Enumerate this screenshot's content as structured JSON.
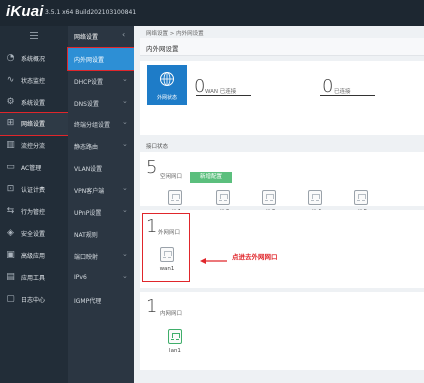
{
  "header": {
    "logo": "iKuai",
    "version": "3.5.1 x64 Build202103100841"
  },
  "sidebar": {
    "items": [
      {
        "label": "系统概况",
        "icon": "dashboard-icon"
      },
      {
        "label": "状态监控",
        "icon": "monitor-icon"
      },
      {
        "label": "系统设置",
        "icon": "gear-icon"
      },
      {
        "label": "网络设置",
        "icon": "network-icon"
      },
      {
        "label": "流控分流",
        "icon": "flow-icon"
      },
      {
        "label": "AC管理",
        "icon": "ac-icon"
      },
      {
        "label": "认证计费",
        "icon": "auth-icon"
      },
      {
        "label": "行为管控",
        "icon": "behavior-icon"
      },
      {
        "label": "安全设置",
        "icon": "shield-icon"
      },
      {
        "label": "高级应用",
        "icon": "advanced-icon"
      },
      {
        "label": "应用工具",
        "icon": "tools-icon"
      },
      {
        "label": "日志中心",
        "icon": "log-icon"
      }
    ]
  },
  "subnav": {
    "header": "网络设置",
    "items": [
      {
        "label": "内外网设置"
      },
      {
        "label": "DHCP设置"
      },
      {
        "label": "DNS设置"
      },
      {
        "label": "终端分组设置"
      },
      {
        "label": "静态路由"
      },
      {
        "label": "VLAN设置"
      },
      {
        "label": "VPN客户端"
      },
      {
        "label": "UPnP设置"
      },
      {
        "label": "NAT规则"
      },
      {
        "label": "端口映射"
      },
      {
        "label": "IPv6"
      },
      {
        "label": "IGMP代理"
      }
    ]
  },
  "main": {
    "breadcrumb": "网络设置 > 内外网设置",
    "title": "内外网设置",
    "wan_status_label": "外网状态",
    "wan_connected_count": "0",
    "wan_connected_label": "WAN 已连接",
    "connected_count": "0",
    "connected_label": "已连接",
    "iface_status_label": "接口状态",
    "idle": {
      "count": "5",
      "label": "空闲网口",
      "add_button": "新增配置",
      "ports": [
        "eth1",
        "eth2",
        "eth3",
        "eth4",
        "eth5"
      ]
    },
    "wan": {
      "count": "1",
      "label": "外网网口",
      "ports": [
        "wan1"
      ]
    },
    "lan": {
      "count": "1",
      "label": "内网网口",
      "ports": [
        "lan1"
      ]
    },
    "annotation": "点进去外网网口"
  },
  "colors": {
    "accent": "#2d8fd5",
    "highlight": "#e0262b",
    "add_button": "#5bbf7d",
    "wan_badge": "#1e7cc8"
  }
}
